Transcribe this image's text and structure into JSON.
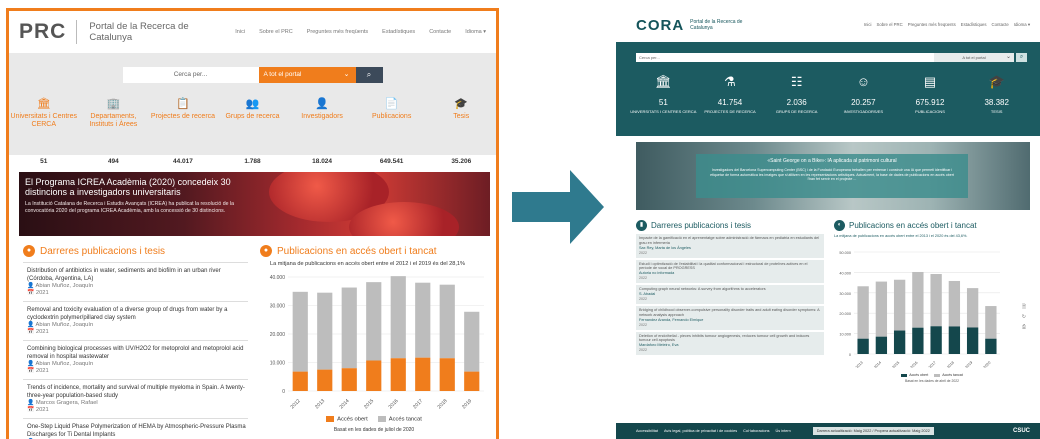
{
  "prc": {
    "logo": "PRC",
    "subtitle": "Portal de la Recerca de Catalunya",
    "nav": [
      "Inici",
      "Sobre el PRC",
      "Preguntes més freqüents",
      "Estadístiques",
      "Contacte",
      "Idioma ▾"
    ],
    "search": {
      "placeholder": "Cerca per...",
      "scope": "A tot el portal"
    },
    "stats": [
      {
        "icon": "university-icon",
        "glyph": "🏛",
        "label": "Universitats i Centres CERCA",
        "count": "51"
      },
      {
        "icon": "department-icon",
        "glyph": "🏢",
        "label": "Departaments, Instituts i Àrees",
        "count": "494"
      },
      {
        "icon": "projects-icon",
        "glyph": "📋",
        "label": "Projectes de recerca",
        "count": "44.017"
      },
      {
        "icon": "groups-icon",
        "glyph": "👥",
        "label": "Grups de recerca",
        "count": "1.788"
      },
      {
        "icon": "researchers-icon",
        "glyph": "👤",
        "label": "Investigadors",
        "count": "18.024"
      },
      {
        "icon": "publications-icon",
        "glyph": "📄",
        "label": "Publicacions",
        "count": "649.541"
      },
      {
        "icon": "thesis-icon",
        "glyph": "🎓",
        "label": "Tesis",
        "count": "35.206"
      }
    ],
    "banner": {
      "title": "El Programa ICREA Acadèmia (2020) concedeix 30 distincions a investigadors universitaris",
      "desc": "La Institució Catalana de Recerca i Estudis Avançats (ICREA) ha publicat la resolució de la convocatòria 2020 del programa ICREA Acadèmia, amb la concessió de 30 distincions."
    },
    "latest_title": "Darreres publicacions i tesis",
    "publications": [
      {
        "title": "Distribution of antibiotics in water, sediments and biofilm in an urban river (Córdoba, Argentina, LA)",
        "author": "Abian Muñoz, Joaquín",
        "year": "2021"
      },
      {
        "title": "Removal and toxicity evaluation of a diverse group of drugs from water by a cyclodextrin polymer/pillared clay system",
        "author": "Abian Muñoz, Joaquín",
        "year": "2021"
      },
      {
        "title": "Combining biological processes with UV/H2O2 for metoprolol and metoprolol acid removal in hospital wastewater",
        "author": "Abian Muñoz, Joaquín",
        "year": "2021"
      },
      {
        "title": "Trends of incidence, mortality and survival of multiple myeloma in Spain. A twenty-three-year population-based study",
        "author": "Marcos Gragera, Rafael",
        "year": "2021"
      },
      {
        "title": "One-Step Liquid Phase Polymerization of HEMA by Atmospheric-Pressure Plasma Discharges for Ti Dental Implants",
        "author": "Gil, J.",
        "year": "2021"
      }
    ],
    "open_access_title": "Publicacions en accés obert i tancat",
    "open_access_sub": "La mitjana de publicacions en accés obert entre el 2012 i el 2019 és del 28,1%",
    "legend_open": "Accés obert",
    "legend_closed": "Accés tancat",
    "note": "Basat en les dades de juliol de 2020",
    "colors": {
      "accent": "#f07d1c",
      "closed": "#bdbdbd"
    }
  },
  "cora": {
    "logo": "CORA",
    "subtitle": "Portal de la Recerca de Catalunya",
    "nav": [
      "Inici",
      "Sobre el PRC",
      "Preguntes més freqüents",
      "Estadístiques",
      "Contacte",
      "Idioma ▾"
    ],
    "search": {
      "placeholder": "Cerca per...",
      "scope": "A tot el portal"
    },
    "stats": [
      {
        "icon": "university-icon",
        "glyph": "🏛",
        "num": "51",
        "label": "UNIVERSITATS I CENTRES CERCA"
      },
      {
        "icon": "flask-icon",
        "glyph": "⚗",
        "num": "41.754",
        "label": "PROJECTES DE RECERCA"
      },
      {
        "icon": "groups-icon",
        "glyph": "☷",
        "num": "2.036",
        "label": "GRUPS DE RECERCA"
      },
      {
        "icon": "researcher-icon",
        "glyph": "☺",
        "num": "20.257",
        "label": "INVESTIGADORS/ES"
      },
      {
        "icon": "publications-icon",
        "glyph": "▤",
        "num": "675.912",
        "label": "PUBLICACIONS"
      },
      {
        "icon": "thesis-icon",
        "glyph": "🎓",
        "num": "38.382",
        "label": "TESIS"
      }
    ],
    "banner": {
      "title": "«Saint George on a Bike»: IA aplicada al patrimoni cultural",
      "desc": "Investigadors del Barcelona Supercomputing Center (BSC) i de la Fundació Europeana treballen per entrenar i construir una IA que permeti identificar i etiquetar de forma automàtica les imatges que s'utilitzen en les representacions artístiques. Actualment, la base de dades de publicacions en accés obert l'han fet servir en el projecte ..."
    },
    "latest_title": "Darreres publicacions i tesis",
    "publications": [
      {
        "title": "Impacte de la gamificació en el aprenentatge sobre administració de fàrmacs en pediatria en estudiants del grau en infermeria",
        "author": "Sax Rey, Marta de los Ángeles",
        "year": "2022"
      },
      {
        "title": "Estudi i optimització de l'estabilitat i la qualitat conformacional i estructural de proteïnes actives en el període de vocal de PROGRESS",
        "author": "Autoria no informada",
        "year": "2022"
      },
      {
        "title": "Computing graph neural networks: A survey from algorithms to accelerators",
        "author": "S. Abadal",
        "year": "2022"
      },
      {
        "title": "Bridging of childhood observer-compulsive personality disorder traits and adult eating disorder symptoms: A network analysis approach",
        "author": "Fernandez Aranda, Fernando Elmique",
        "year": "2022"
      },
      {
        "title": "Deletion of endothelial - pieces inhibits tumour angiogenesis, reduces tumour cell growth and induces tumour cell apoptosis",
        "author": "Mardaforo Meleiro, Eva",
        "year": "2022"
      }
    ],
    "open_access_title": "Publicacions en accés obert i tancat",
    "open_access_sub": "La mitjana de publicacions en accés obert entre el 2013 i el 2020 és del 43,6%.",
    "legend_open": "Accés obert",
    "legend_closed": "Accés tancat",
    "note": "Basat en les dades de abril de 2022",
    "footer": [
      "Accessibilitat",
      "Avís legal, política de privacitat i de cookies",
      "Col·laboracions",
      "Ús intern"
    ],
    "updated": "Darrera actualització: Maig 2022 / Propera actualització: Maig 2022",
    "footer_brand": "CSUC",
    "colors": {
      "accent": "#1c5b61",
      "open": "#14474c",
      "closed": "#bdbdbd"
    }
  },
  "chart_data": [
    {
      "type": "bar",
      "title": "Publicacions en accés obert i tancat",
      "categories": [
        "2012",
        "2013",
        "2014",
        "2015",
        "2016",
        "2017",
        "2018",
        "2019"
      ],
      "series": [
        {
          "name": "Accés obert",
          "values": [
            6800,
            7500,
            8000,
            10700,
            11500,
            11700,
            11500,
            6800
          ]
        },
        {
          "name": "Accés tancat",
          "values": [
            28000,
            27000,
            28300,
            27500,
            28800,
            26300,
            25800,
            21000
          ]
        }
      ],
      "ylim": [
        0,
        40000
      ],
      "yticks": [
        "0",
        "10.000",
        "20.000",
        "30.000",
        "40.000"
      ]
    },
    {
      "type": "bar",
      "title": "Publicacions en accés obert i tancat",
      "categories": [
        "2013",
        "2014",
        "2015",
        "2016",
        "2017",
        "2018",
        "2019",
        "2020"
      ],
      "series": [
        {
          "name": "Accés obert",
          "values": [
            7500,
            8500,
            11500,
            12900,
            13600,
            13500,
            13000,
            7500
          ]
        },
        {
          "name": "Accés tancat",
          "values": [
            25700,
            27000,
            24900,
            27300,
            25600,
            22300,
            19300,
            16000
          ]
        }
      ],
      "ylim": [
        0,
        50000
      ],
      "yticks": [
        "0",
        "10.000",
        "20.000",
        "30.000",
        "40.000",
        "50.000"
      ]
    }
  ]
}
